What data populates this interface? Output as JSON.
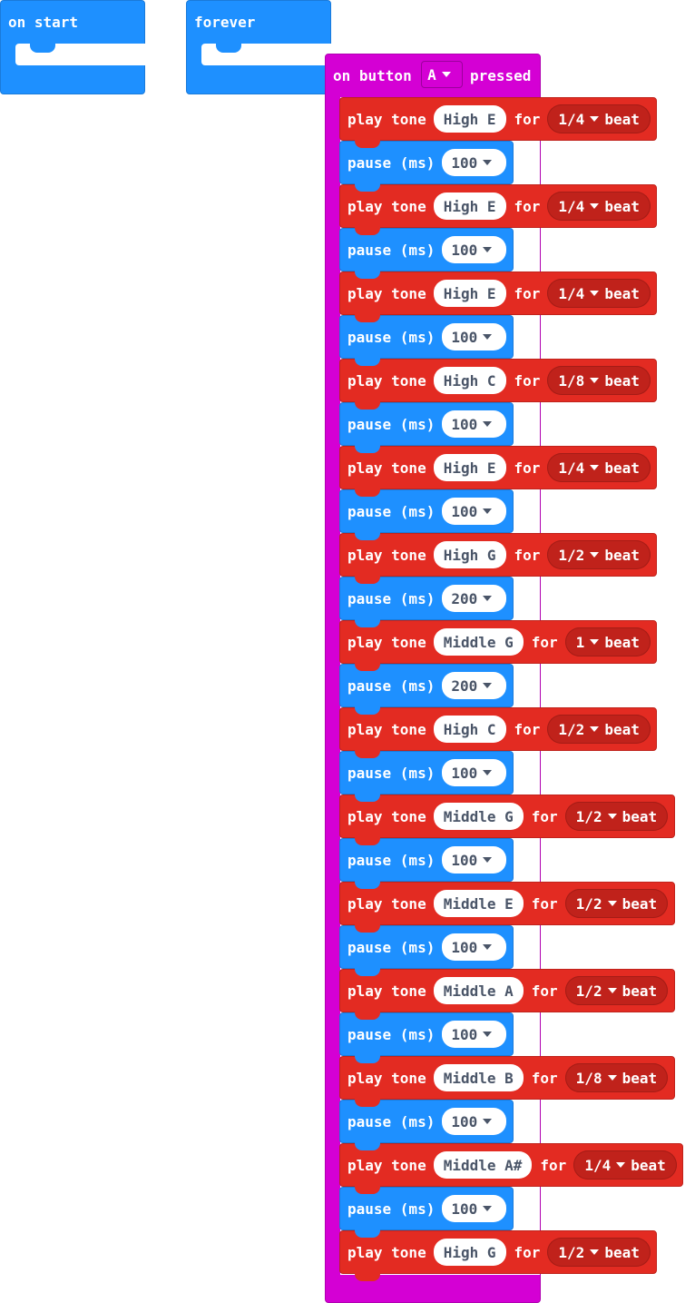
{
  "blocks": {
    "on_start": {
      "label": "on start"
    },
    "forever": {
      "label": "forever"
    },
    "on_button": {
      "label_prefix": "on button",
      "button": "A",
      "label_suffix": "pressed"
    }
  },
  "statement_words": {
    "play_tone": "play tone",
    "for": "for",
    "beat": "beat",
    "pause": "pause (ms)"
  },
  "sequence": [
    {
      "type": "tone",
      "note": "High E",
      "beat": "1/4"
    },
    {
      "type": "pause",
      "ms": "100"
    },
    {
      "type": "tone",
      "note": "High E",
      "beat": "1/4"
    },
    {
      "type": "pause",
      "ms": "100"
    },
    {
      "type": "tone",
      "note": "High E",
      "beat": "1/4"
    },
    {
      "type": "pause",
      "ms": "100"
    },
    {
      "type": "tone",
      "note": "High C",
      "beat": "1/8"
    },
    {
      "type": "pause",
      "ms": "100"
    },
    {
      "type": "tone",
      "note": "High E",
      "beat": "1/4"
    },
    {
      "type": "pause",
      "ms": "100"
    },
    {
      "type": "tone",
      "note": "High G",
      "beat": "1/2"
    },
    {
      "type": "pause",
      "ms": "200"
    },
    {
      "type": "tone",
      "note": "Middle G",
      "beat": "1"
    },
    {
      "type": "pause",
      "ms": "200"
    },
    {
      "type": "tone",
      "note": "High C",
      "beat": "1/2"
    },
    {
      "type": "pause",
      "ms": "100"
    },
    {
      "type": "tone",
      "note": "Middle G",
      "beat": "1/2"
    },
    {
      "type": "pause",
      "ms": "100"
    },
    {
      "type": "tone",
      "note": "Middle E",
      "beat": "1/2"
    },
    {
      "type": "pause",
      "ms": "100"
    },
    {
      "type": "tone",
      "note": "Middle A",
      "beat": "1/2"
    },
    {
      "type": "pause",
      "ms": "100"
    },
    {
      "type": "tone",
      "note": "Middle B",
      "beat": "1/8"
    },
    {
      "type": "pause",
      "ms": "100"
    },
    {
      "type": "tone",
      "note": "Middle A#",
      "beat": "1/4"
    },
    {
      "type": "pause",
      "ms": "100"
    },
    {
      "type": "tone",
      "note": "High G",
      "beat": "1/2"
    }
  ],
  "colors": {
    "basic_blue": "#1e90ff",
    "music_red": "#e32b22",
    "input_magenta": "#d400d4"
  }
}
